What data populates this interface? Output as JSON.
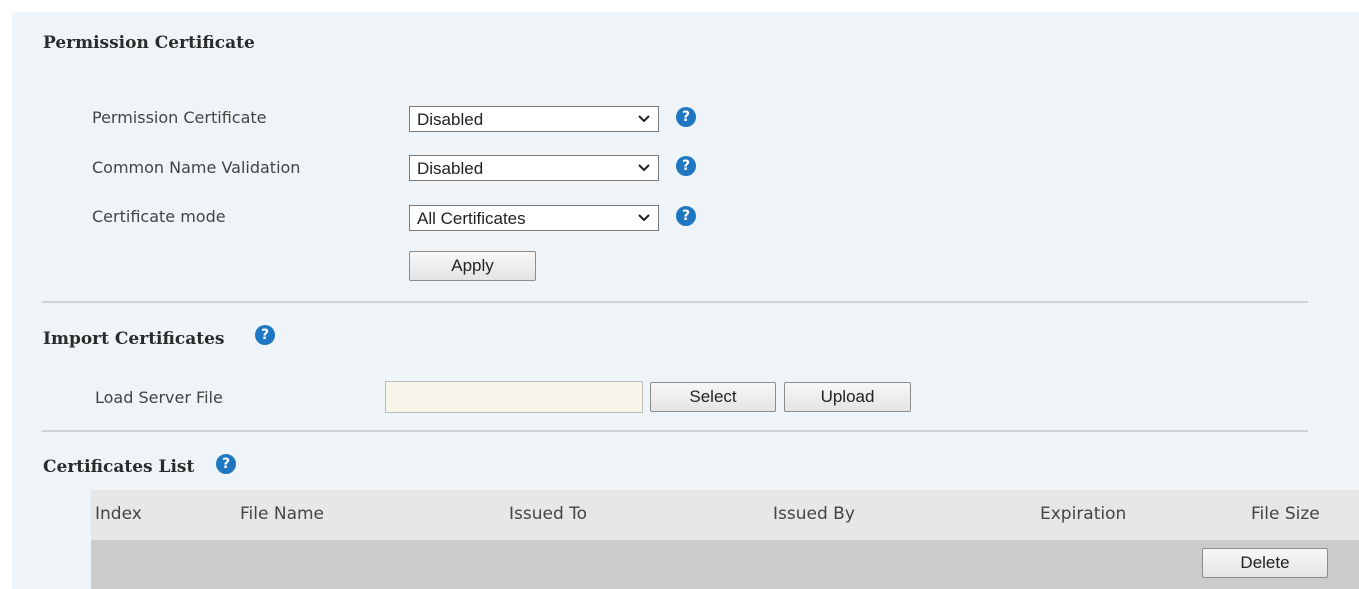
{
  "permission_section": {
    "title": "Permission Certificate",
    "fields": [
      {
        "label": "Permission Certificate",
        "value": "Disabled"
      },
      {
        "label": "Common Name Validation",
        "value": "Disabled"
      },
      {
        "label": "Certificate mode",
        "value": "All Certificates"
      }
    ],
    "help_symbol": "?",
    "apply_label": "Apply"
  },
  "import_section": {
    "title": "Import Certificates",
    "help_symbol": "?",
    "load_label": "Load Server File",
    "file_value": "",
    "select_label": "Select",
    "upload_label": "Upload"
  },
  "list_section": {
    "title": "Certificates List",
    "help_symbol": "?",
    "columns": [
      "Index",
      "File Name",
      "Issued To",
      "Issued By",
      "Expiration",
      "File Size"
    ],
    "delete_label": "Delete"
  },
  "colors": {
    "panel_bg": "#eef4f7",
    "help_icon": "#1f77c2",
    "table_header_bg": "#e7e7e7",
    "table_row_bg": "#cbcbcb",
    "file_input_bg": "#f7f5ea"
  },
  "icons": [
    "help-icon",
    "chevron-down-icon"
  ]
}
